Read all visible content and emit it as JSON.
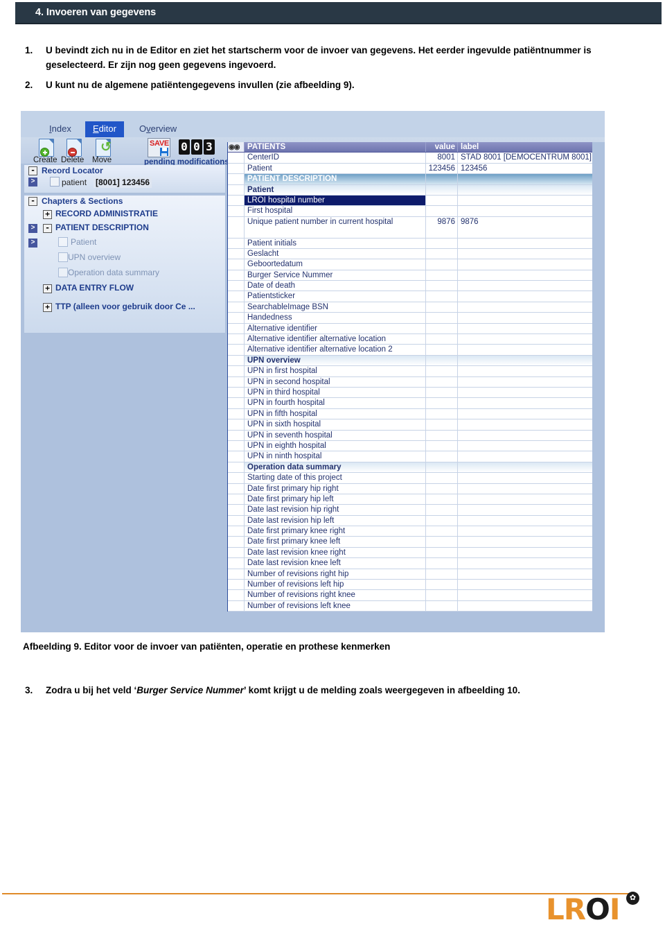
{
  "page": {
    "header_title": "4. Invoeren van gegevens"
  },
  "instructions": [
    {
      "number": "1.",
      "text": "U bevindt zich nu in de Editor en ziet het startscherm voor de invoer van gegevens. Het eerder ingevulde patiëntnummer is geselecteerd. Er zijn nog geen gegevens ingevoerd."
    },
    {
      "number": "2.",
      "text": "U kunt nu de algemene patiëntengegevens invullen (zie afbeelding 9)."
    }
  ],
  "figure": {
    "caption": "Afbeelding 9. Editor voor de invoer van patiënten, operatie en prothese kenmerken"
  },
  "instruction3": {
    "number": "3.",
    "prefix": "Zodra u bij het veld ‘",
    "italic": "Burger Service Nummer",
    "suffix": "’ komt krijgt u de melding zoals weergegeven in afbeelding 10."
  },
  "app": {
    "tabs": [
      {
        "label": "Index",
        "accesskey": "I",
        "active": false
      },
      {
        "label": "Editor",
        "accesskey": "E",
        "active": true
      },
      {
        "label": "Overview",
        "accesskey": "v",
        "active": false
      }
    ],
    "toolbar": {
      "create_label": "Create",
      "delete_label": "Delete",
      "move_label": "Move",
      "save_label": "SAVE",
      "counter": [
        "0",
        "0",
        "3"
      ],
      "cancel_glyph": "✕",
      "pending_label": "pending modifications"
    },
    "record_locator": {
      "expander": "-",
      "title": "Record Locator",
      "arrow": ">",
      "item_label": "patient",
      "item_id": "[8001] 123456"
    },
    "chapters": {
      "expander": "-",
      "title": "Chapters & Sections",
      "nodes": [
        {
          "label": "RECORD ADMINISTRATIE",
          "expander": "+",
          "type": "chapter",
          "arrow": ""
        },
        {
          "label": "PATIENT DESCRIPTION",
          "expander": "-",
          "type": "chapter",
          "arrow": ">"
        },
        {
          "label": "Patient",
          "expander": "",
          "type": "leaf",
          "arrow": ">"
        },
        {
          "label": "UPN overview",
          "expander": "",
          "type": "leaf",
          "arrow": ""
        },
        {
          "label": "Operation data summary",
          "expander": "",
          "type": "leaf",
          "arrow": ""
        },
        {
          "label": "DATA ENTRY FLOW",
          "expander": "+",
          "type": "chapter",
          "arrow": ""
        },
        {
          "label": "TTP (alleen voor gebruik door Ce ...",
          "expander": "+",
          "type": "chapter",
          "arrow": ""
        }
      ]
    },
    "grid": {
      "columns": {
        "name": "PATIENTS",
        "value": "value",
        "label": "label"
      },
      "rows": [
        {
          "name": "PATIENTS",
          "value": "value",
          "label": "label",
          "style": "hdr"
        },
        {
          "name": "CenterID",
          "value": "8001",
          "label": "STAD 8001 [DEMOCENTRUM 8001]",
          "style": "normal"
        },
        {
          "name": "Patient",
          "value": "123456",
          "label": "123456",
          "style": "normal"
        },
        {
          "name": "PATIENT DESCRIPTION",
          "value": "",
          "label": "",
          "style": "section"
        },
        {
          "name": "Patient",
          "value": "",
          "label": "",
          "style": "subsection"
        },
        {
          "name": "LROI hospital number",
          "value": "",
          "label": "",
          "style": "selected"
        },
        {
          "name": "First hospital",
          "value": "",
          "label": "",
          "style": "normal"
        },
        {
          "name": "Unique patient number in current hospital",
          "value": "9876",
          "label": "9876",
          "style": "tall"
        },
        {
          "name": "Patient initials",
          "value": "",
          "label": "",
          "style": "normal"
        },
        {
          "name": "Geslacht",
          "value": "",
          "label": "",
          "style": "normal"
        },
        {
          "name": "Geboortedatum",
          "value": "",
          "label": "",
          "style": "normal"
        },
        {
          "name": "Burger Service Nummer",
          "value": "",
          "label": "",
          "style": "normal"
        },
        {
          "name": "Date of death",
          "value": "",
          "label": "",
          "style": "normal"
        },
        {
          "name": "Patientsticker",
          "value": "",
          "label": "",
          "style": "normal"
        },
        {
          "name": "SearchableImage BSN",
          "value": "",
          "label": "",
          "style": "normal"
        },
        {
          "name": "Handedness",
          "value": "",
          "label": "",
          "style": "normal"
        },
        {
          "name": "Alternative identifier",
          "value": "",
          "label": "",
          "style": "normal"
        },
        {
          "name": "Alternative identifier alternative location",
          "value": "",
          "label": "",
          "style": "normal"
        },
        {
          "name": "Alternative identifier alternative location 2",
          "value": "",
          "label": "",
          "style": "normal"
        },
        {
          "name": "UPN overview",
          "value": "",
          "label": "",
          "style": "subsection"
        },
        {
          "name": "UPN in first hospital",
          "value": "",
          "label": "",
          "style": "normal"
        },
        {
          "name": "UPN in second hospital",
          "value": "",
          "label": "",
          "style": "normal"
        },
        {
          "name": "UPN in third hospital",
          "value": "",
          "label": "",
          "style": "normal"
        },
        {
          "name": "UPN in fourth hospital",
          "value": "",
          "label": "",
          "style": "normal"
        },
        {
          "name": "UPN in fifth hospital",
          "value": "",
          "label": "",
          "style": "normal"
        },
        {
          "name": "UPN in sixth hospital",
          "value": "",
          "label": "",
          "style": "normal"
        },
        {
          "name": "UPN in seventh hospital",
          "value": "",
          "label": "",
          "style": "normal"
        },
        {
          "name": "UPN in eighth hospital",
          "value": "",
          "label": "",
          "style": "normal"
        },
        {
          "name": "UPN in ninth hospital",
          "value": "",
          "label": "",
          "style": "normal"
        },
        {
          "name": "Operation data summary",
          "value": "",
          "label": "",
          "style": "subsection"
        },
        {
          "name": "Starting date of this project",
          "value": "",
          "label": "",
          "style": "normal"
        },
        {
          "name": "Date first primary hip right",
          "value": "",
          "label": "",
          "style": "normal"
        },
        {
          "name": "Date first primary hip left",
          "value": "",
          "label": "",
          "style": "normal"
        },
        {
          "name": "Date last revision hip right",
          "value": "",
          "label": "",
          "style": "normal"
        },
        {
          "name": "Date last revision hip left",
          "value": "",
          "label": "",
          "style": "normal"
        },
        {
          "name": "Date first primary knee right",
          "value": "",
          "label": "",
          "style": "normal"
        },
        {
          "name": "Date first primary knee left",
          "value": "",
          "label": "",
          "style": "normal"
        },
        {
          "name": "Date last revision knee right",
          "value": "",
          "label": "",
          "style": "normal"
        },
        {
          "name": "Date last revision knee left",
          "value": "",
          "label": "",
          "style": "normal"
        },
        {
          "name": "Number of revisions right hip",
          "value": "",
          "label": "",
          "style": "normal"
        },
        {
          "name": "Number of revisions left hip",
          "value": "",
          "label": "",
          "style": "normal"
        },
        {
          "name": "Number of revisions right knee",
          "value": "",
          "label": "",
          "style": "normal"
        },
        {
          "name": "Number of revisions left knee",
          "value": "",
          "label": "",
          "style": "normal"
        }
      ]
    }
  },
  "footer": {
    "logo_lr": "LR",
    "logo_o": "O",
    "logo_i": "I",
    "logo_mark": "✿"
  },
  "colors": {
    "header_bg": "#293845",
    "accent_orange": "#e8922d",
    "app_bg": "#aec1dd",
    "tab_active": "#2156c8",
    "grid_selected": "#0d1b6b"
  }
}
